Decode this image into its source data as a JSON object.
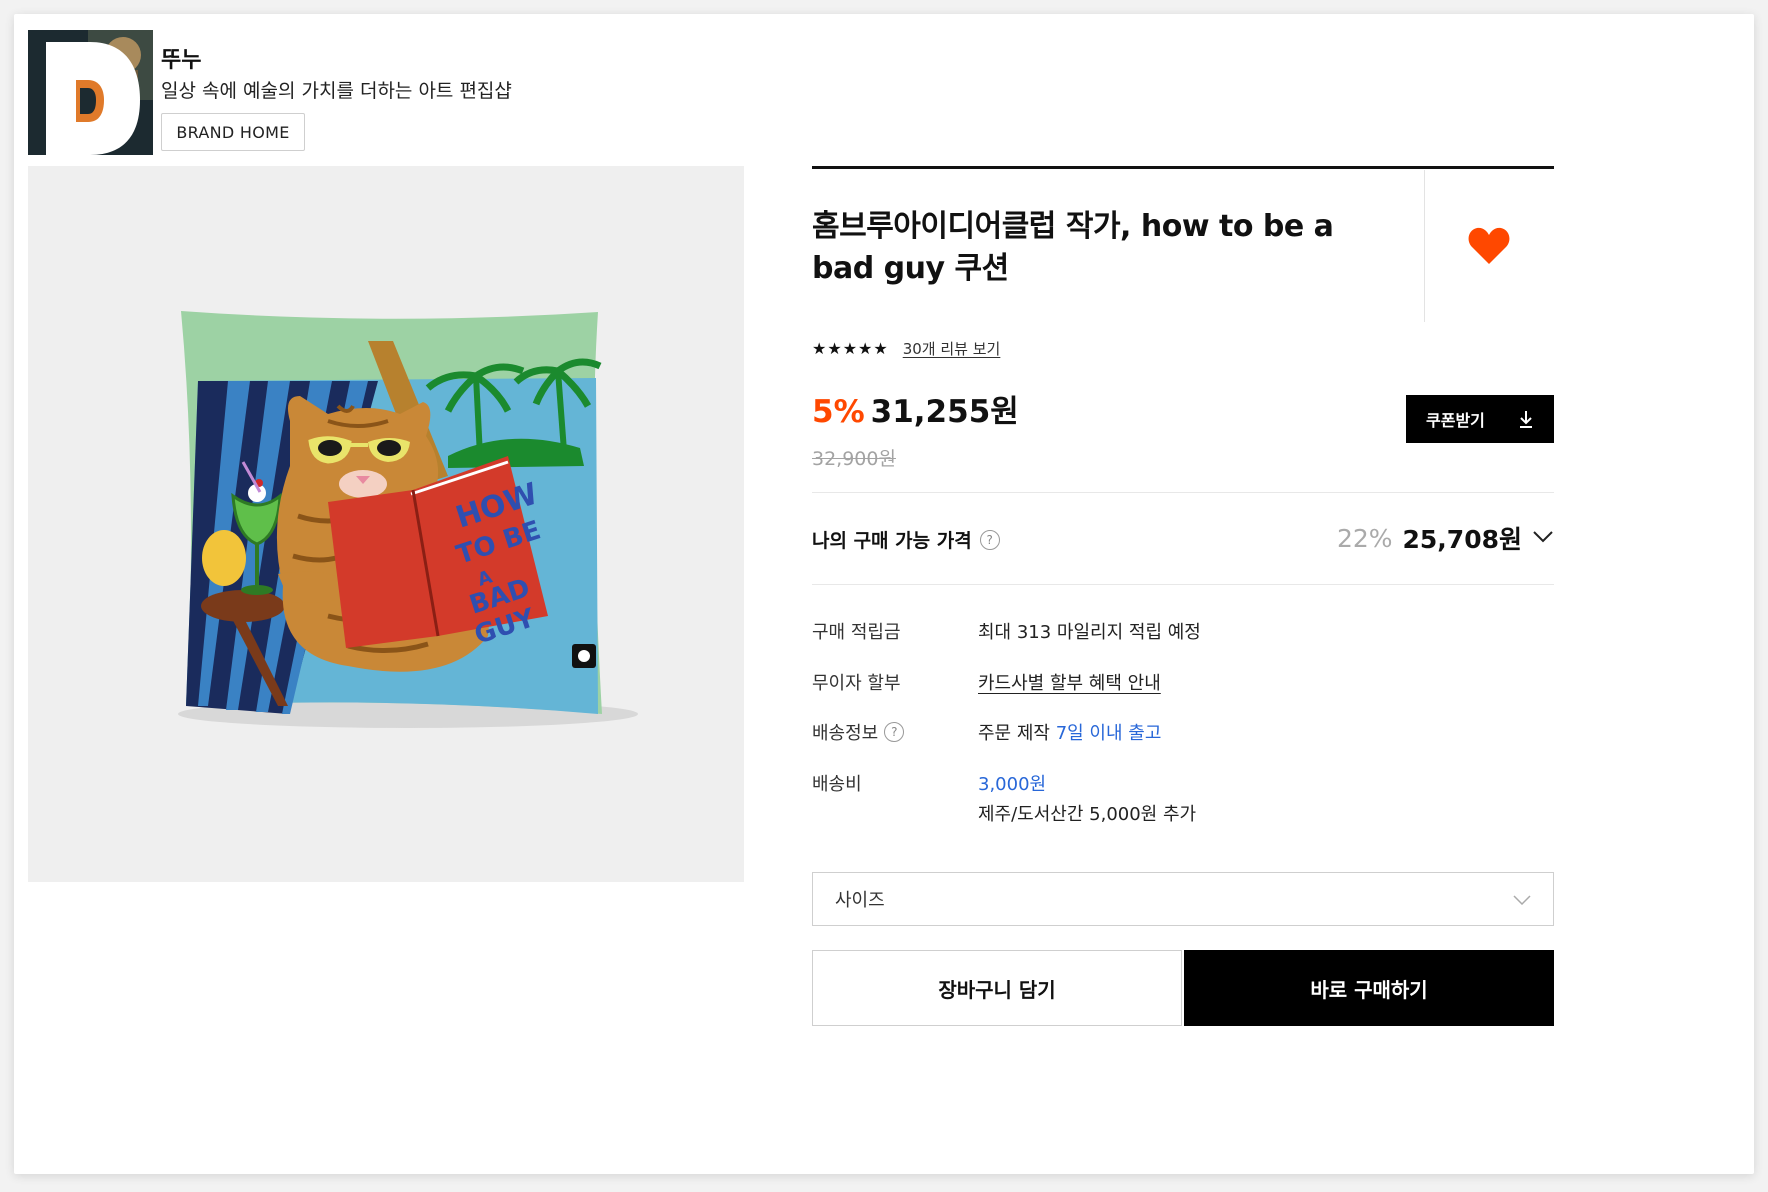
{
  "brand": {
    "name": "뚜누",
    "description": "일상 속에 예술의 가치를 더하는 아트 편집샵",
    "home_button": "BRAND HOME",
    "logo_letter": "D"
  },
  "product": {
    "title": "홈브루아이디어클럽 작가, how to be a bad guy 쿠션",
    "rating_stars": "★★★★★",
    "rating": 5,
    "review_link": "30개 리뷰 보기",
    "discount_rate": "5%",
    "price": "31,255원",
    "original_price": "32,900원",
    "coupon_button": "쿠폰받기",
    "wishlist_liked": true,
    "image_book_text": "HOW TO BE A BAD GUY"
  },
  "my_price": {
    "label": "나의 구매 가능 가격",
    "discount_rate": "22%",
    "price": "25,708원"
  },
  "details": {
    "points_label": "구매 적립금",
    "points_value": "최대 313 마일리지 적립 예정",
    "installment_label": "무이자 할부",
    "installment_value": "카드사별 할부 혜택 안내",
    "shipping_label": "배송정보",
    "shipping_prefix": "주문 제작",
    "shipping_highlight": "7일 이내 출고",
    "fee_label": "배송비",
    "fee_value": "3,000원",
    "fee_extra": "제주/도서산간 5,000원 추가"
  },
  "options": {
    "size_placeholder": "사이즈"
  },
  "actions": {
    "cart": "장바구니 담기",
    "buy": "바로 구매하기"
  },
  "colors": {
    "accent_orange": "#ff4800",
    "heart": "#ff4800",
    "link_blue": "#2867d8",
    "black": "#000000"
  }
}
